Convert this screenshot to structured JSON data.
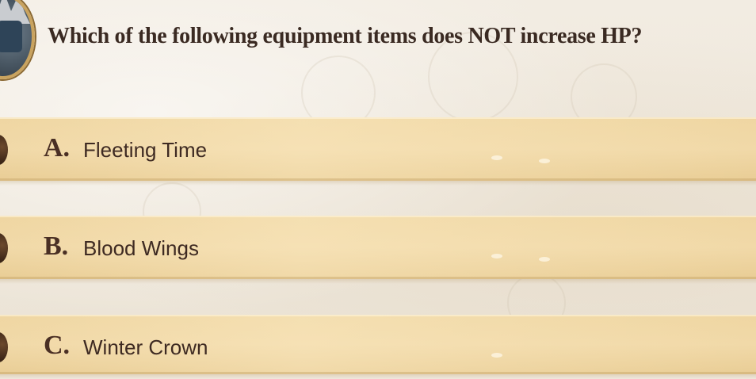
{
  "quiz": {
    "question": "Which of the following equipment items does NOT increase HP?",
    "options": [
      {
        "letter": "A.",
        "text": "Fleeting Time"
      },
      {
        "letter": "B.",
        "text": "Blood Wings"
      },
      {
        "letter": "C.",
        "text": "Winter Crown"
      }
    ]
  },
  "colors": {
    "accent_text": "#4a2f24",
    "option_bg": "#efd6a2",
    "page_bg": "#efe8dc"
  },
  "icons": {
    "avatar": "character-portrait-icon"
  }
}
